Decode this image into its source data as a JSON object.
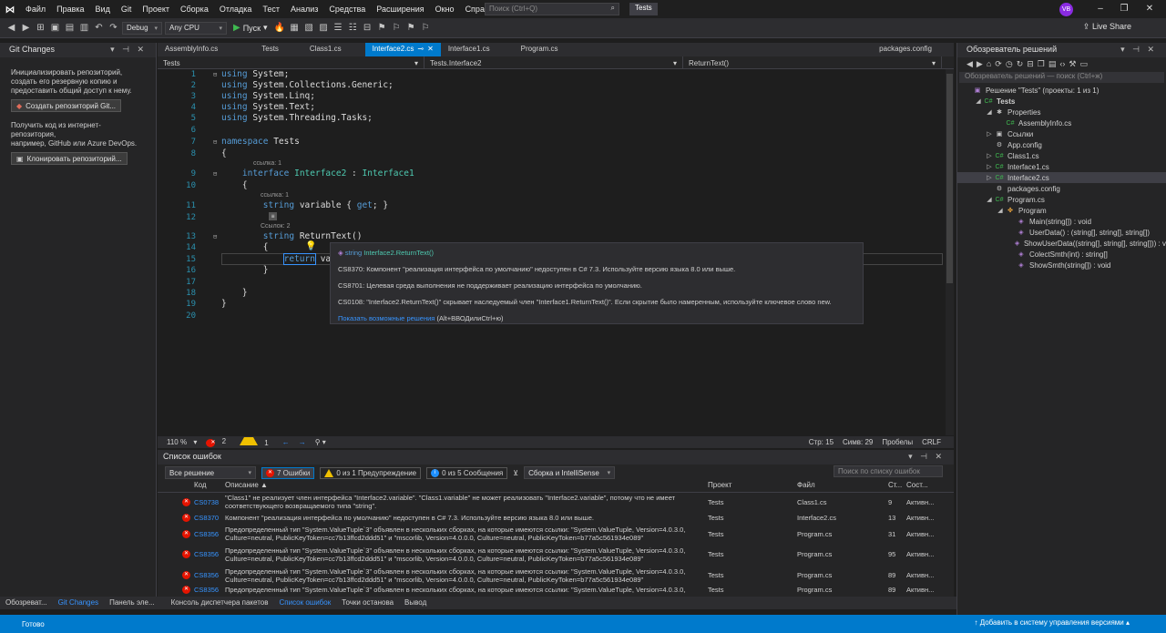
{
  "menubar": {
    "items": [
      "Файл",
      "Правка",
      "Вид",
      "Git",
      "Проект",
      "Сборка",
      "Отладка",
      "Тест",
      "Анализ",
      "Средства",
      "Расширения",
      "Окно",
      "Справка"
    ],
    "search_placeholder": "Поиск (Ctrl+Q)",
    "solution_name": "Tests",
    "avatar": "VB"
  },
  "toolbar": {
    "config": "Debug",
    "platform": "Any CPU",
    "run_label": "Пуск",
    "live_share": "Live Share"
  },
  "git_changes": {
    "title": "Git Changes",
    "init_text": [
      "Инициализировать репозиторий,",
      "создать его резервную копию и",
      "предоставить общий доступ к нему."
    ],
    "create_repo_btn": "Создать репозиторий Git...",
    "clone_text": [
      "Получить код из интернет-репозитория,",
      "например, GitHub или Azure DevOps."
    ],
    "clone_btn": "Клонировать репозиторий..."
  },
  "editor_tabs": [
    {
      "label": "AssemblyInfo.cs",
      "active": false
    },
    {
      "label": "Tests",
      "active": false
    },
    {
      "label": "Class1.cs",
      "active": false
    },
    {
      "label": "Interface2.cs",
      "active": true
    },
    {
      "label": "Interface1.cs",
      "active": false
    },
    {
      "label": "Program.cs",
      "active": false
    }
  ],
  "packages_tab": "packages.config",
  "navbar": {
    "project": "Tests",
    "type": "Tests.Interface2",
    "member": "ReturnText()"
  },
  "code_lines": [
    {
      "n": "1",
      "text": "using System;"
    },
    {
      "n": "2",
      "text": "using System.Collections.Generic;"
    },
    {
      "n": "3",
      "text": "using System.Linq;"
    },
    {
      "n": "4",
      "text": "using System.Text;"
    },
    {
      "n": "5",
      "text": "using System.Threading.Tasks;"
    },
    {
      "n": "6",
      "text": ""
    },
    {
      "n": "7",
      "text": "namespace Tests"
    },
    {
      "n": "8",
      "text": "{"
    },
    {
      "n": "9",
      "text": "    interface Interface2 : Interface1"
    },
    {
      "n": "10",
      "text": "    {"
    },
    {
      "n": "11",
      "text": "        string variable { get; }"
    },
    {
      "n": "12",
      "text": ""
    },
    {
      "n": "13",
      "text": "        string ReturnText()"
    },
    {
      "n": "14",
      "text": "        {"
    },
    {
      "n": "15",
      "text": "            return vari"
    },
    {
      "n": "16",
      "text": "        }"
    },
    {
      "n": "17",
      "text": ""
    },
    {
      "n": "18",
      "text": "    }"
    },
    {
      "n": "19",
      "text": "}"
    },
    {
      "n": "20",
      "text": ""
    }
  ],
  "codelens": {
    "refs1": "ссылка: 1",
    "refs1b": "ссылка: 1",
    "refs2": "Ссылок: 2"
  },
  "tooltip": {
    "signature_kw": "string",
    "signature_rest": "Interface2.ReturnText()",
    "e1": "CS8370: Компонент \"реализация интерфейса по умолчанию\" недоступен в C# 7.3. Используйте версию языка 8.0 или выше.",
    "e2": "CS8701: Целевая среда выполнения не поддерживает реализацию интерфейса по умолчанию.",
    "e3": "CS0108: \"Interface2.ReturnText()\" скрывает наследуемый член \"Interface1.ReturnText()\". Если скрытие было намеренным, используйте ключевое слово new.",
    "link": "Показать возможные решения",
    "shortcut": "(Alt+ВВОДилиCtrl+ю)"
  },
  "editor_status": {
    "zoom": "110 %",
    "errors": "2",
    "warnings": "1",
    "line": "Стр: 15",
    "col": "Симв: 29",
    "spaces": "Пробелы",
    "eol": "CRLF"
  },
  "error_list": {
    "title": "Список ошибок",
    "scope": "Все решение",
    "errors_btn": "7 Ошибки",
    "warnings_btn": "0 из 1 Предупреждение",
    "messages_btn": "0 из 5 Сообщения",
    "build_filter": "Сборка и IntelliSense",
    "search_placeholder": "Поиск по списку ошибок",
    "headers": {
      "code": "Код",
      "desc": "Описание",
      "project": "Проект",
      "file": "Файл",
      "line": "Ст...",
      "state": "Сост..."
    },
    "rows": [
      {
        "code": "CS0738",
        "desc1": "\"Class1\" не реализует член интерфейса \"Interface2.variable\". \"Class1.variable\" не может реализовать \"Interface2.variable\", потому что не имеет",
        "desc2": "соответствующего возвращаемого типа \"string\".",
        "project": "Tests",
        "file": "Class1.cs",
        "line": "9",
        "state": "Активн..."
      },
      {
        "code": "CS8370",
        "desc1": "Компонент \"реализация интерфейса по умолчанию\" недоступен в C# 7.3. Используйте версию языка 8.0 или выше.",
        "desc2": "",
        "project": "Tests",
        "file": "Interface2.cs",
        "line": "13",
        "state": "Активн..."
      },
      {
        "code": "CS8356",
        "desc1": "Предопределенный тип \"System.ValueTuple`3\" объявлен в нескольких сборках, на которые имеются ссылки: \"System.ValueTuple, Version=4.0.3.0,",
        "desc2": "Culture=neutral, PublicKeyToken=cc7b13ffcd2ddd51\" и \"mscorlib, Version=4.0.0.0, Culture=neutral, PublicKeyToken=b77a5c561934e089\"",
        "project": "Tests",
        "file": "Program.cs",
        "line": "31",
        "state": "Активн..."
      },
      {
        "code": "CS8356",
        "desc1": "Предопределенный тип \"System.ValueTuple`3\" объявлен в нескольких сборках, на которые имеются ссылки: \"System.ValueTuple, Version=4.0.3.0,",
        "desc2": "Culture=neutral, PublicKeyToken=cc7b13ffcd2ddd51\" и \"mscorlib, Version=4.0.0.0, Culture=neutral, PublicKeyToken=b77a5c561934e089\"",
        "project": "Tests",
        "file": "Program.cs",
        "line": "95",
        "state": "Активн..."
      },
      {
        "code": "CS8356",
        "desc1": "Предопределенный тип \"System.ValueTuple`3\" объявлен в нескольких сборках, на которые имеются ссылки: \"System.ValueTuple, Version=4.0.3.0,",
        "desc2": "Culture=neutral, PublicKeyToken=cc7b13ffcd2ddd51\" и \"mscorlib, Version=4.0.0.0, Culture=neutral, PublicKeyToken=b77a5c561934e089\"",
        "project": "Tests",
        "file": "Program.cs",
        "line": "89",
        "state": "Активн..."
      },
      {
        "code": "CS8356",
        "desc1": "Предопределенный тип \"System.ValueTuple`3\" объявлен в нескольких сборках, на которые имеются ссылки: \"System.ValueTuple, Version=4.0.3.0,",
        "desc2": "",
        "project": "Tests",
        "file": "Program.cs",
        "line": "89",
        "state": "Активн..."
      }
    ]
  },
  "bottom_tabs": [
    "Обозреват...",
    "Git Changes",
    "Панель эле...",
    "Консоль диспетчера пакетов",
    "Список ошибок",
    "Точки останова",
    "Вывод"
  ],
  "status": {
    "ready": "Готово",
    "vcs": "Добавить в систему управления версиями"
  },
  "solution_explorer": {
    "title": "Обозреватель решений",
    "search_placeholder": "Обозреватель решений — поиск (Ctrl+ж)",
    "tree": [
      {
        "label": "Решение \"Tests\" (проекты: 1 из 1)",
        "indent": 0,
        "arrow": "",
        "icon": "solution-icon",
        "sel": false,
        "bold": false
      },
      {
        "label": "Tests",
        "indent": 1,
        "arrow": "◢",
        "icon": "project-icon",
        "sel": false,
        "bold": true
      },
      {
        "label": "Properties",
        "indent": 2,
        "arrow": "◢",
        "icon": "wrench-icon",
        "sel": false,
        "bold": false
      },
      {
        "label": "AssemblyInfo.cs",
        "indent": 3,
        "arrow": "",
        "icon": "cs-file-icon",
        "sel": false,
        "bold": false
      },
      {
        "label": "Ссылки",
        "indent": 2,
        "arrow": "▷",
        "icon": "references-icon",
        "sel": false,
        "bold": false
      },
      {
        "label": "App.config",
        "indent": 2,
        "arrow": "",
        "icon": "config-icon",
        "sel": false,
        "bold": false
      },
      {
        "label": "Class1.cs",
        "indent": 2,
        "arrow": "▷",
        "icon": "cs-file-icon",
        "sel": false,
        "bold": false
      },
      {
        "label": "Interface1.cs",
        "indent": 2,
        "arrow": "▷",
        "icon": "cs-file-icon",
        "sel": false,
        "bold": false
      },
      {
        "label": "Interface2.cs",
        "indent": 2,
        "arrow": "▷",
        "icon": "cs-file-icon",
        "sel": true,
        "bold": false
      },
      {
        "label": "packages.config",
        "indent": 2,
        "arrow": "",
        "icon": "config-icon",
        "sel": false,
        "bold": false
      },
      {
        "label": "Program.cs",
        "indent": 2,
        "arrow": "◢",
        "icon": "cs-file-icon",
        "sel": false,
        "bold": false
      },
      {
        "label": "Program",
        "indent": 3,
        "arrow": "◢",
        "icon": "class-icon",
        "sel": false,
        "bold": false
      },
      {
        "label": "Main(string[]) : void",
        "indent": 4,
        "arrow": "",
        "icon": "method-icon",
        "sel": false,
        "bold": false
      },
      {
        "label": "UserData() : (string[], string[], string[])",
        "indent": 4,
        "arrow": "",
        "icon": "method-icon",
        "sel": false,
        "bold": false
      },
      {
        "label": "ShowUserData((string[], string[], string[])) : v",
        "indent": 4,
        "arrow": "",
        "icon": "method-icon",
        "sel": false,
        "bold": false
      },
      {
        "label": "ColectSmth(int) : string[]",
        "indent": 4,
        "arrow": "",
        "icon": "method-icon",
        "sel": false,
        "bold": false
      },
      {
        "label": "ShowSmth(string[]) : void",
        "indent": 4,
        "arrow": "",
        "icon": "method-icon",
        "sel": false,
        "bold": false
      }
    ]
  }
}
